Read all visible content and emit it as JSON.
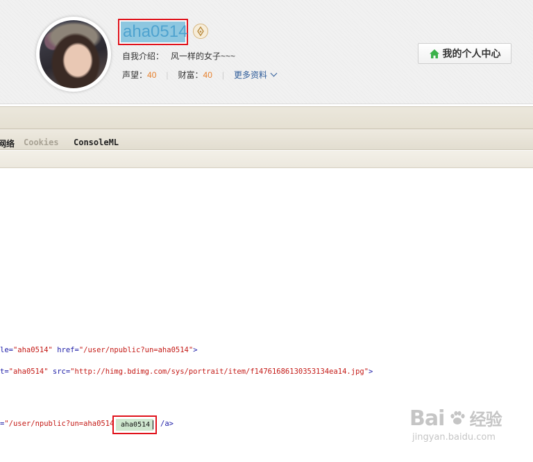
{
  "profile": {
    "username": "aha0514",
    "intro_label": "自我介绍：",
    "intro_value": "风一样的女子~~~",
    "reputation_label": "声望：",
    "reputation_value": "40",
    "wealth_label": "财富：",
    "wealth_value": "40",
    "more_label": "更多资料",
    "center_button_label": "我的个人中心",
    "avatar_icon": "user-avatar-photo",
    "badge_icon": "pen-nib-badge-icon",
    "home_icon": "home-icon"
  },
  "devtools": {
    "tabs": [
      "网络",
      "Cookies",
      "ConsoleML"
    ],
    "code_lines": [
      {
        "lead": "le=",
        "attr1_val": "\"aha0514\"",
        "attr2": " href=",
        "attr2_val": "\"/user/npublic?un=aha0514\"",
        "tail": ">"
      },
      {
        "lead": "t=",
        "attr1_val": "\"aha0514\"",
        "attr2": " src=",
        "attr2_val": "\"http://himg.bdimg.com/sys/portrait/item/f14761686130353134ea14.jpg\"",
        "tail": ">"
      },
      {
        "lead": "=",
        "attr1_val": "\"/user/npublic?un=aha0514\"",
        "selected_text": "aha0514",
        "tail": "/a>"
      }
    ]
  },
  "colors": {
    "highlight_border": "#e0121b",
    "username_bg": "#8ec7e0",
    "stat_number": "#e7802c",
    "link_blue": "#2e5c9a",
    "attr_value_red": "#c41a16",
    "home_icon_green": "#3bb24a"
  },
  "watermark": {
    "brand": "Bai",
    "brand_suffix": "经验",
    "site": "jingyan.baidu.com"
  }
}
